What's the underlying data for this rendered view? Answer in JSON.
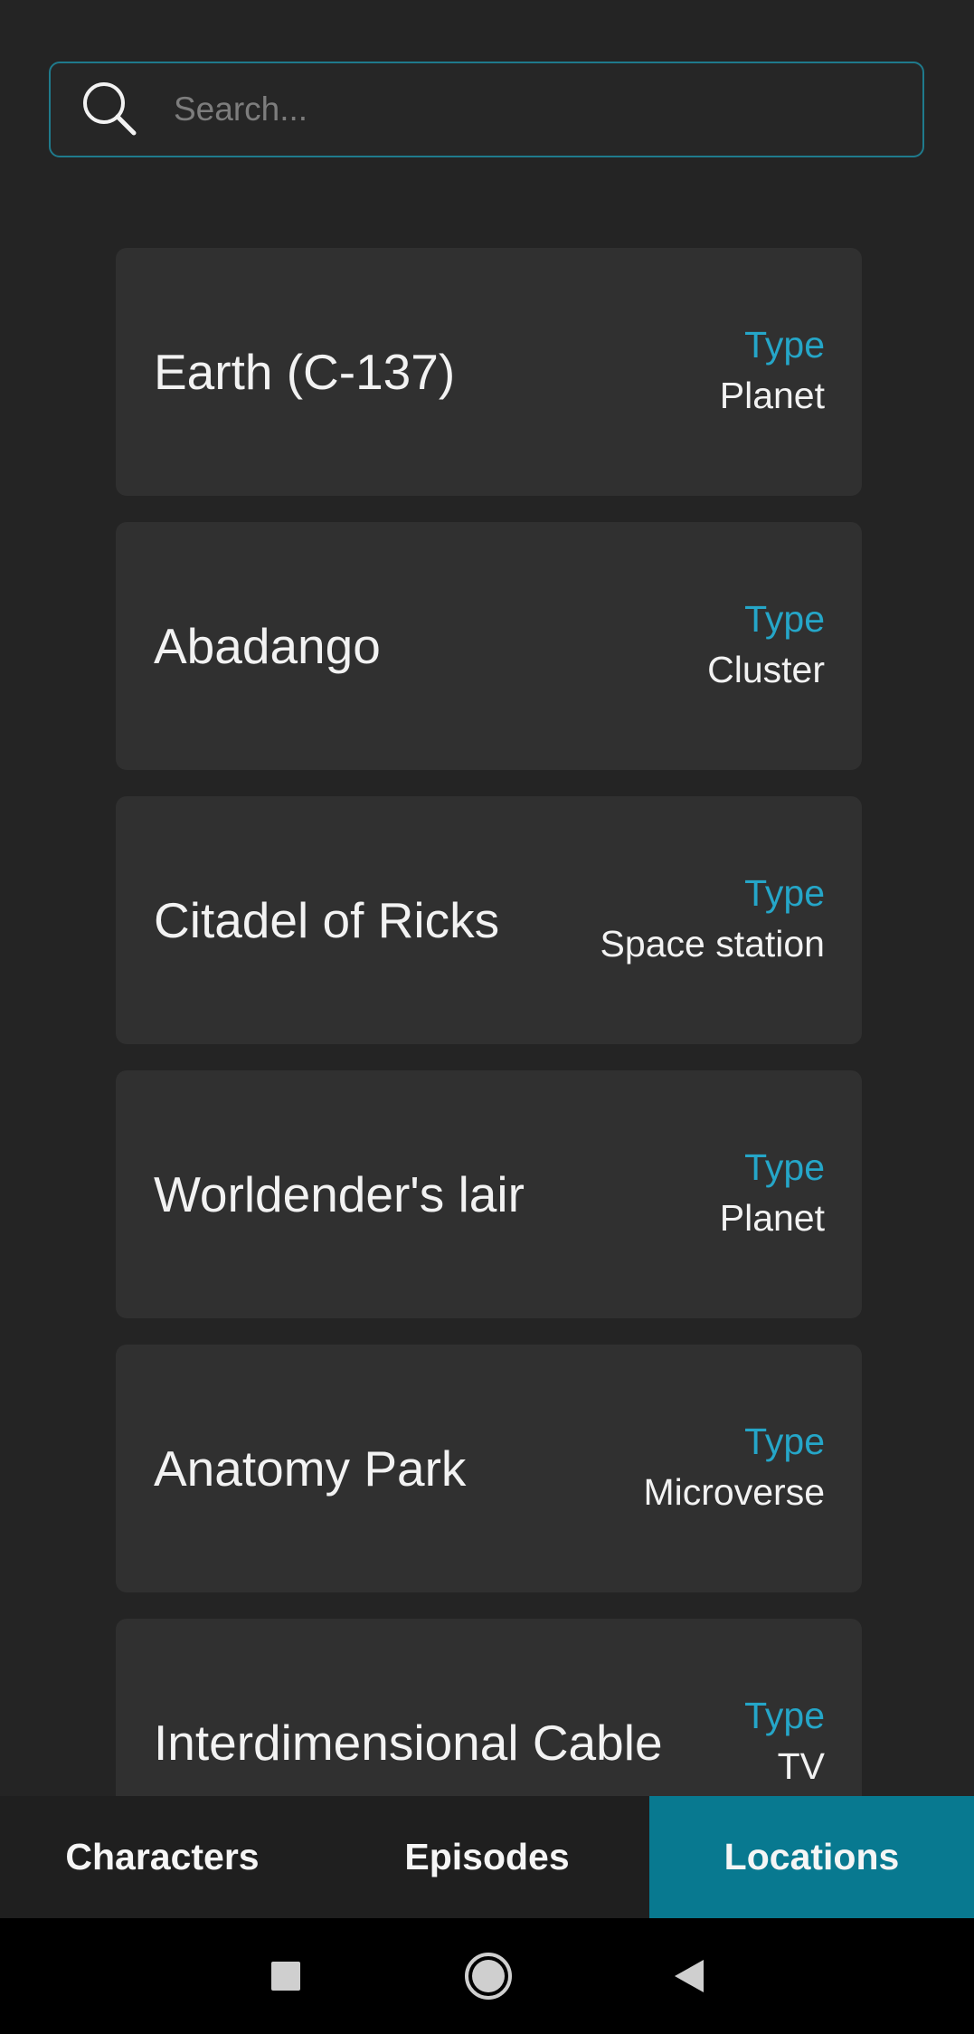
{
  "search": {
    "placeholder": "Search...",
    "value": "",
    "icon": "search-icon",
    "border_color": "#1f7a8c"
  },
  "locations": [
    {
      "name": "Earth (C-137)",
      "type_label": "Type",
      "type": "Planet"
    },
    {
      "name": "Abadango",
      "type_label": "Type",
      "type": "Cluster"
    },
    {
      "name": "Citadel of Ricks",
      "type_label": "Type",
      "type": "Space station"
    },
    {
      "name": "Worldender's lair",
      "type_label": "Type",
      "type": "Planet"
    },
    {
      "name": "Anatomy Park",
      "type_label": "Type",
      "type": "Microverse"
    },
    {
      "name": "Interdimensional Cable",
      "type_label": "Type",
      "type": "TV"
    }
  ],
  "tabs": [
    {
      "label": "Characters",
      "active": false
    },
    {
      "label": "Episodes",
      "active": false
    },
    {
      "label": "Locations",
      "active": true
    }
  ],
  "system_nav": {
    "recents": "square-icon",
    "home": "circle-icon",
    "back": "triangle-back-icon"
  },
  "colors": {
    "background": "#242424",
    "card": "#303030",
    "accent_text": "#25a6c8",
    "active_tab": "#087990",
    "tab_bar": "#1f1f1f"
  }
}
